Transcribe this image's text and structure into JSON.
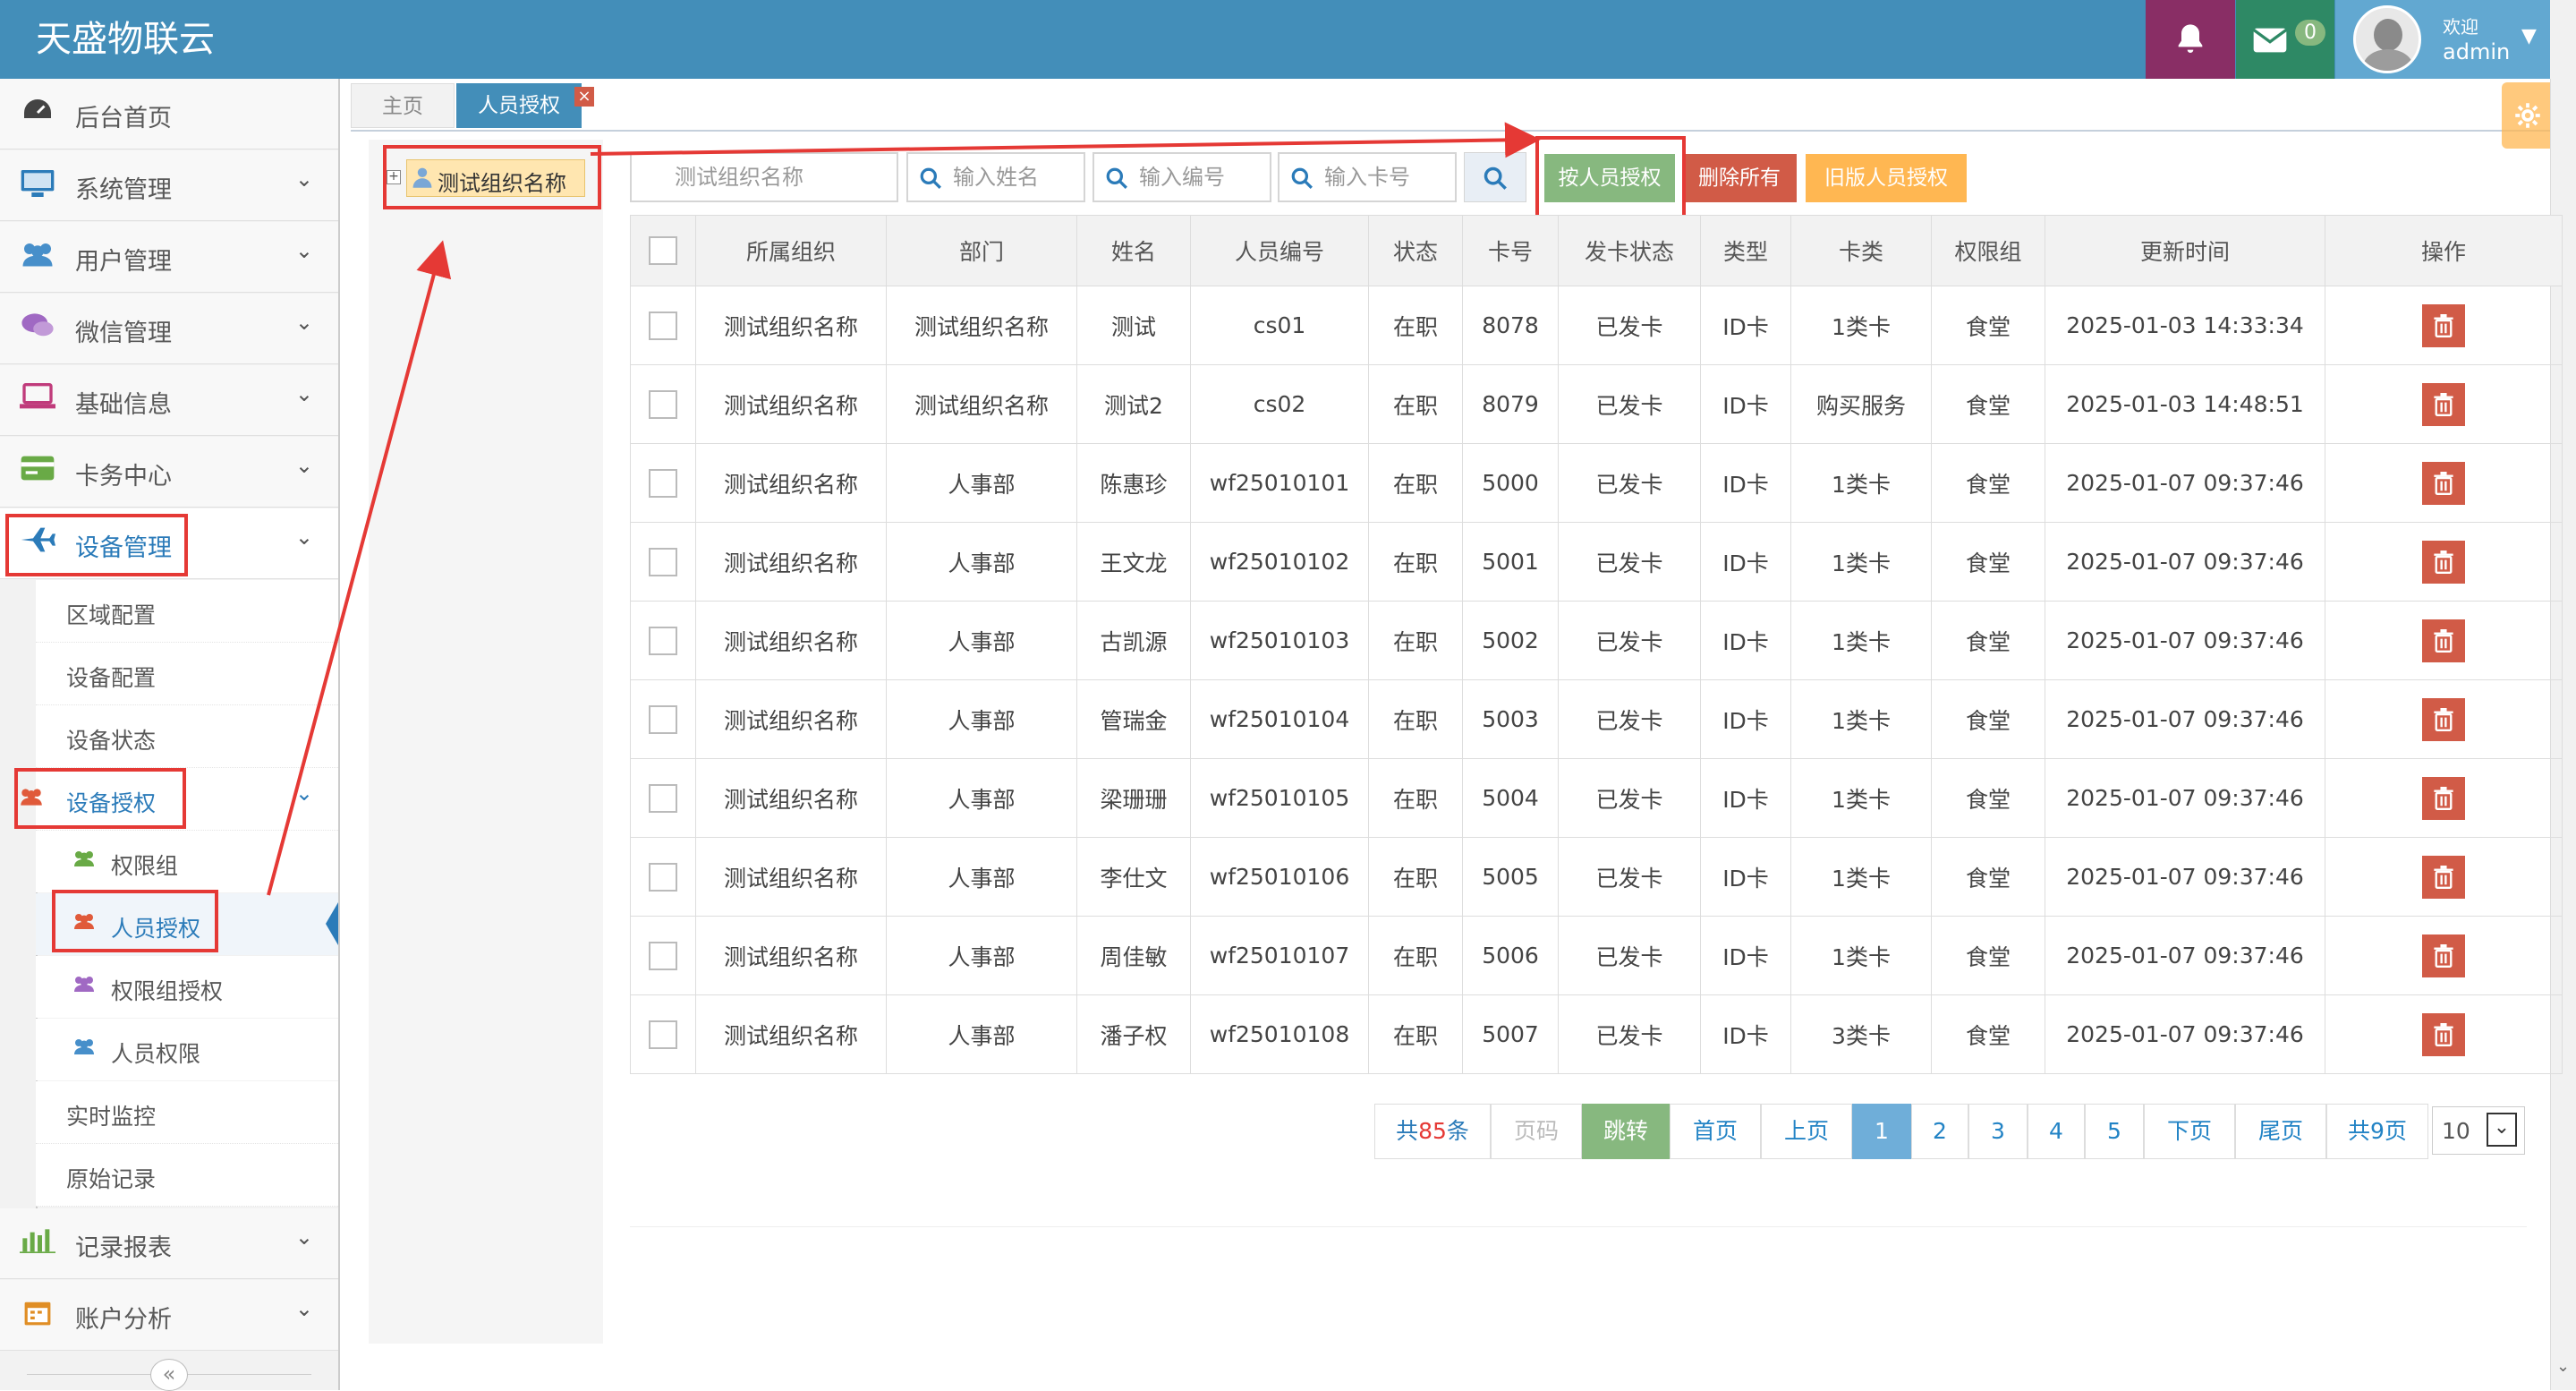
{
  "app": {
    "title": "天盛物联云"
  },
  "topbar": {
    "bell_icon": "bell-icon",
    "mail_icon": "envelope-icon",
    "mail_count": "0",
    "welcome": "欢迎",
    "username": "admin"
  },
  "sidebar": {
    "items": [
      {
        "label": "后台首页",
        "icon": "dashboard-icon"
      },
      {
        "label": "系统管理",
        "icon": "desktop-icon"
      },
      {
        "label": "用户管理",
        "icon": "users-icon"
      },
      {
        "label": "微信管理",
        "icon": "comments-icon"
      },
      {
        "label": "基础信息",
        "icon": "laptop-icon"
      },
      {
        "label": "卡务中心",
        "icon": "credit-card-icon"
      },
      {
        "label": "设备管理",
        "icon": "plane-icon"
      }
    ],
    "device_sub": [
      "区域配置",
      "设备配置",
      "设备状态",
      "设备授权"
    ],
    "auth_sub": [
      "权限组",
      "人员授权",
      "权限组授权",
      "人员权限"
    ],
    "device_sub_after": [
      "实时监控",
      "原始记录"
    ],
    "bottom_items": [
      {
        "label": "记录报表",
        "icon": "bar-chart-icon"
      },
      {
        "label": "账户分析",
        "icon": "calendar-icon"
      }
    ],
    "collapse": "«"
  },
  "tabs": [
    {
      "label": "主页"
    },
    {
      "label": "人员授权"
    }
  ],
  "tree": {
    "root": "测试组织名称"
  },
  "filters": {
    "org_placeholder": "测试组织名称",
    "name_placeholder": "输入姓名",
    "code_placeholder": "输入编号",
    "card_placeholder": "输入卡号"
  },
  "actions": {
    "auth_by_person": "按人员授权",
    "delete_all": "删除所有",
    "old_auth": "旧版人员授权"
  },
  "table": {
    "headers": [
      "所属组织",
      "部门",
      "姓名",
      "人员编号",
      "状态",
      "卡号",
      "发卡状态",
      "类型",
      "卡类",
      "权限组",
      "更新时间",
      "操作"
    ],
    "rows": [
      [
        "测试组织名称",
        "测试组织名称",
        "测试",
        "cs01",
        "在职",
        "8078",
        "已发卡",
        "ID卡",
        "1类卡",
        "食堂",
        "2025-01-03 14:33:34"
      ],
      [
        "测试组织名称",
        "测试组织名称",
        "测试2",
        "cs02",
        "在职",
        "8079",
        "已发卡",
        "ID卡",
        "购买服务",
        "食堂",
        "2025-01-03 14:48:51"
      ],
      [
        "测试组织名称",
        "人事部",
        "陈惠珍",
        "wf25010101",
        "在职",
        "5000",
        "已发卡",
        "ID卡",
        "1类卡",
        "食堂",
        "2025-01-07 09:37:46"
      ],
      [
        "测试组织名称",
        "人事部",
        "王文龙",
        "wf25010102",
        "在职",
        "5001",
        "已发卡",
        "ID卡",
        "1类卡",
        "食堂",
        "2025-01-07 09:37:46"
      ],
      [
        "测试组织名称",
        "人事部",
        "古凯源",
        "wf25010103",
        "在职",
        "5002",
        "已发卡",
        "ID卡",
        "1类卡",
        "食堂",
        "2025-01-07 09:37:46"
      ],
      [
        "测试组织名称",
        "人事部",
        "管瑞金",
        "wf25010104",
        "在职",
        "5003",
        "已发卡",
        "ID卡",
        "1类卡",
        "食堂",
        "2025-01-07 09:37:46"
      ],
      [
        "测试组织名称",
        "人事部",
        "梁珊珊",
        "wf25010105",
        "在职",
        "5004",
        "已发卡",
        "ID卡",
        "1类卡",
        "食堂",
        "2025-01-07 09:37:46"
      ],
      [
        "测试组织名称",
        "人事部",
        "李仕文",
        "wf25010106",
        "在职",
        "5005",
        "已发卡",
        "ID卡",
        "1类卡",
        "食堂",
        "2025-01-07 09:37:46"
      ],
      [
        "测试组织名称",
        "人事部",
        "周佳敏",
        "wf25010107",
        "在职",
        "5006",
        "已发卡",
        "ID卡",
        "1类卡",
        "食堂",
        "2025-01-07 09:37:46"
      ],
      [
        "测试组织名称",
        "人事部",
        "潘子权",
        "wf25010108",
        "在职",
        "5007",
        "已发卡",
        "ID卡",
        "3类卡",
        "食堂",
        "2025-01-07 09:37:46"
      ]
    ]
  },
  "pager": {
    "total_prefix": "共",
    "total_count": "85",
    "total_suffix": "条",
    "page_input_placeholder": "页码",
    "jump": "跳转",
    "first": "首页",
    "prev": "上页",
    "pages": [
      "1",
      "2",
      "3",
      "4",
      "5"
    ],
    "current": "1",
    "next": "下页",
    "last": "尾页",
    "total_pages": "共9页",
    "page_size": "10"
  },
  "colors": {
    "topbar": "#438eb9",
    "active_tab": "#438eb9",
    "btn_green": "#87b87f",
    "btn_red": "#d15b47",
    "btn_orange": "#ffb752",
    "annotation": "#e53935"
  }
}
